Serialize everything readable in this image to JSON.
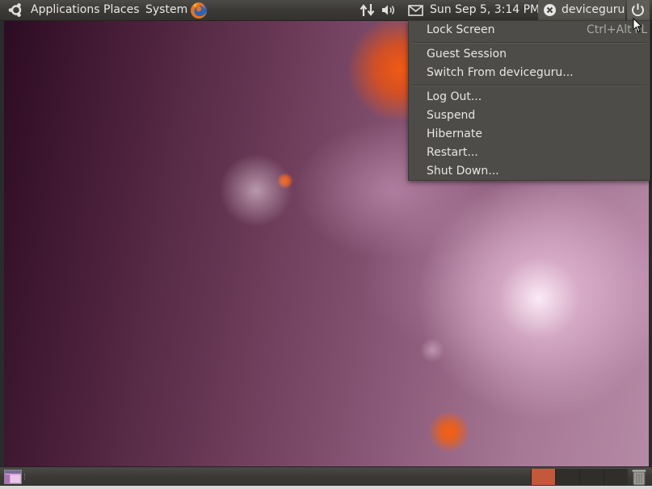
{
  "top_panel": {
    "applications_label": "Applications",
    "places_label": "Places",
    "system_label": "System",
    "clock_text": "Sun Sep  5,  3:14 PM",
    "user_name": "deviceguru",
    "icons": {
      "ubuntu_logo": "ubuntu-logo-icon",
      "browser": "firefox-icon",
      "network": "network-updown-icon",
      "volume": "speaker-icon",
      "mail": "envelope-icon",
      "user_status": "user-status-icon",
      "power": "power-icon"
    }
  },
  "session_menu": {
    "lock_screen": "Lock Screen",
    "lock_screen_accel": "Ctrl+Alt+L",
    "guest_session": "Guest Session",
    "switch_user": "Switch From deviceguru...",
    "log_out": "Log Out...",
    "suspend": "Suspend",
    "hibernate": "Hibernate",
    "restart": "Restart...",
    "shut_down": "Shut Down..."
  },
  "bottom_panel": {
    "workspace_count": 4,
    "active_workspace": 1,
    "icons": {
      "show_desktop": "show-desktop-icon",
      "trash": "trash-icon"
    }
  },
  "colors": {
    "panel_bg": "#3b3a36",
    "menu_bg": "#4d4c48",
    "active_workspace": "#c4583a",
    "desktop_orange": "#f05a14"
  }
}
